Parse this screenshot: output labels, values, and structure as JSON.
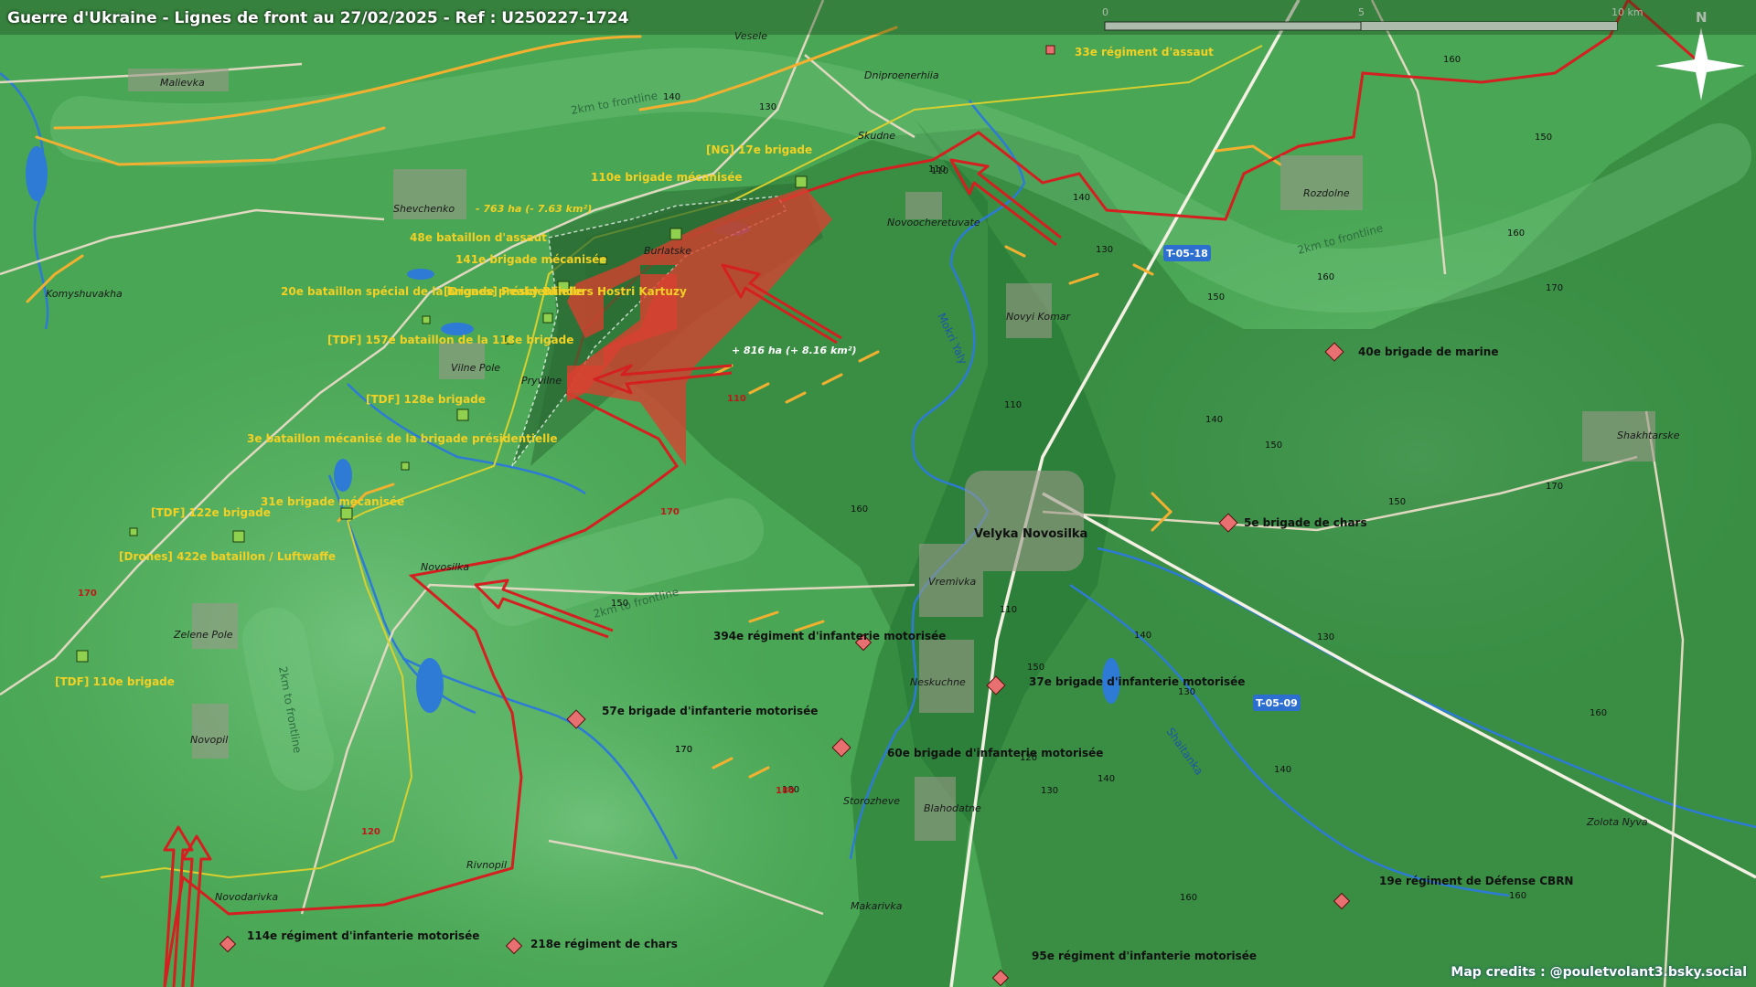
{
  "header": {
    "title": "Guerre d'Ukraine - Lignes de front au 27/02/2025 - Ref : U250227-1724"
  },
  "credits": "Map credits : @pouletvolant3.bsky.social",
  "scale": {
    "labels": [
      "0",
      "5",
      "10 km"
    ]
  },
  "compass": {
    "label": "N"
  },
  "colors": {
    "ukraine_land": "#3f9a4a",
    "occupied_land": "#2b7a37",
    "frontline": "#d42020",
    "russian_gains": "#d94030",
    "ukr_unit": "#8fd14f",
    "rus_unit": "#e87070",
    "rivers": "#2e7bd6",
    "roads": "#e0d8c0"
  },
  "areas": {
    "loss": "- 763 ha (- 7.63 km²)",
    "gain": "+ 816 ha (+ 8.16 km²)"
  },
  "frontline_buffer_labels": [
    "2km to frontline",
    "2km to frontline",
    "2km to frontline",
    "2km to frontline"
  ],
  "towns": [
    "Vesele",
    "Malievka",
    "Dniproenerhiia",
    "Skudne",
    "Shevchenko",
    "Burlatske",
    "Novoocheretuvate",
    "Rozdolne",
    "Komyshuvakha",
    "Novyi Komar",
    "Vilne Pole",
    "Pryvilne",
    "Shakhtarske",
    "Velyka Novosilka",
    "Novosilka",
    "Vremivka",
    "Zelene Pole",
    "Neskuchne",
    "Novopil",
    "Storozheve",
    "Blahodatne",
    "Rivnopil",
    "Zolota Nyva",
    "Novodarivka",
    "Makarivka"
  ],
  "rivers": [
    "Mokri Yaly",
    "Shaitanka"
  ],
  "road_labels": [
    "T-05-18",
    "T-05-09"
  ],
  "elevations": [
    "140",
    "130",
    "160",
    "150",
    "110",
    "130",
    "110",
    "140",
    "150",
    "160",
    "130",
    "170",
    "110",
    "150",
    "140",
    "160",
    "170",
    "150",
    "170",
    "160",
    "170",
    "150",
    "140",
    "130",
    "140",
    "160",
    "170",
    "180",
    "150",
    "160",
    "130",
    "140",
    "120",
    "160",
    "110",
    "110",
    "180",
    "170",
    "120"
  ],
  "ukr_units": [
    "110e brigade mécanisée",
    "[NG] 17e brigade",
    "48e bataillon d'assaut",
    "141e brigade mécanisée",
    "20e bataillon spécial de la brigade présidentielle",
    "[Drones] Peaky Blinders Hostri Kartuzy",
    "[TDF] 157e bataillon de la 118e brigade",
    "[TDF] 128e brigade",
    "3e bataillon mécanisé de la brigade présidentielle",
    "31e brigade mécanisée",
    "[TDF] 122e brigade",
    "[Drones] 422e bataillon / Luftwaffe",
    "[TDF] 110e brigade"
  ],
  "rus_units": [
    "33e régiment d'assaut",
    "40e brigade de marine",
    "5e brigade de chars",
    "394e régiment d'infanterie motorisée",
    "37e brigade d'infanterie motorisée",
    "57e brigade d'infanterie motorisée",
    "60e brigade d'infanterie motorisée",
    "114e régiment d'infanterie motorisée",
    "218e régiment de chars",
    "19e régiment de Défense CBRN",
    "95e régiment d'infanterie motorisée"
  ]
}
